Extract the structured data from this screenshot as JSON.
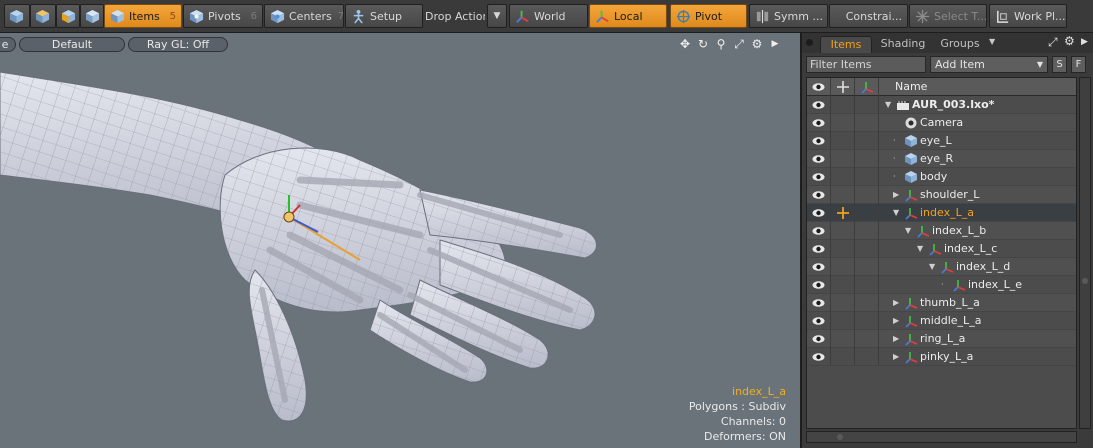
{
  "toolbar": {
    "items_label": "Items",
    "items_num": "5",
    "pivots_label": "Pivots",
    "pivots_num": "6",
    "centers_label": "Centers",
    "centers_num": "7",
    "setup_label": "Setup",
    "drop_action_label": "Drop Action",
    "world_label": "World",
    "local_label": "Local",
    "pivot_label": "Pivot",
    "symmetry_label": "Symm ...",
    "constraints_label": "Constrai...",
    "select_through_label": "Select T...",
    "work_plane_label": "Work Pl..."
  },
  "viewport": {
    "mode_label": "e",
    "shading_label": "Default",
    "raygl_label": "Ray GL: Off",
    "info": {
      "selection": "index_L_a",
      "polygons": "Polygons : Subdiv",
      "channels": "Channels: 0",
      "deformers": "Deformers: ON"
    }
  },
  "panel": {
    "tabs": [
      "Items",
      "Shading",
      "Groups"
    ],
    "filter_placeholder": "Filter Items",
    "add_item_label": "Add Item",
    "s_label": "S",
    "f_label": "F",
    "name_header": "Name",
    "rows": [
      {
        "label": "AUR_003.lxo*",
        "icon": "scene-icon"
      },
      {
        "label": "Camera",
        "icon": "camera-icon"
      },
      {
        "label": "eye_L",
        "icon": "mesh-icon"
      },
      {
        "label": "eye_R",
        "icon": "mesh-icon"
      },
      {
        "label": "body",
        "icon": "mesh-icon"
      },
      {
        "label": "shoulder_L",
        "icon": "locator-icon"
      },
      {
        "label": "index_L_a",
        "icon": "locator-icon"
      },
      {
        "label": "index_L_b",
        "icon": "locator-icon"
      },
      {
        "label": "index_L_c",
        "icon": "locator-icon"
      },
      {
        "label": "index_L_d",
        "icon": "locator-icon"
      },
      {
        "label": "index_L_e",
        "icon": "locator-icon"
      },
      {
        "label": "thumb_L_a",
        "icon": "locator-icon"
      },
      {
        "label": "middle_L_a",
        "icon": "locator-icon"
      },
      {
        "label": "ring_L_a",
        "icon": "locator-icon"
      },
      {
        "label": "pinky_L_a",
        "icon": "locator-icon"
      }
    ]
  },
  "colors": {
    "accent": "#f0a020",
    "viewport_bg": "#6a727a",
    "panel_bg": "#3b3b3b"
  }
}
